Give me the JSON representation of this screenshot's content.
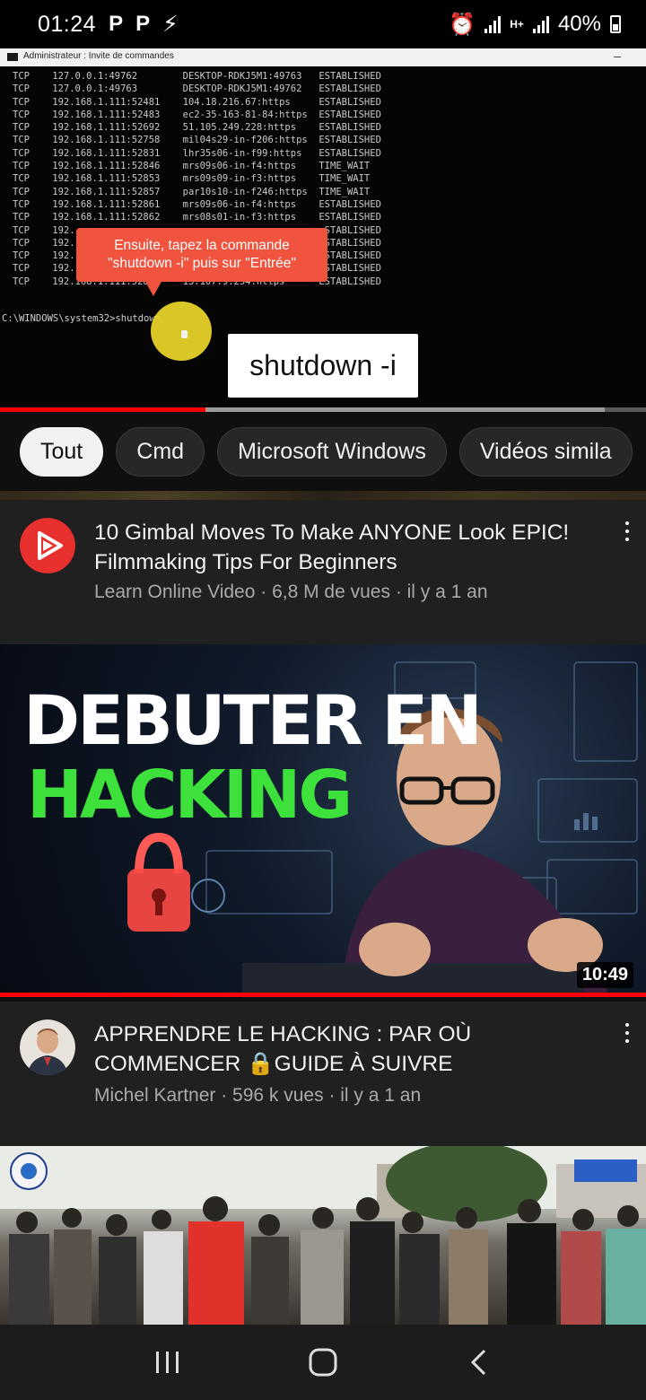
{
  "status_bar": {
    "time": "01:24",
    "left_icons": [
      "P",
      "P"
    ],
    "network": "H+",
    "battery": "40%"
  },
  "player": {
    "window_title": "Administrateur : Invite de commandes",
    "cmd_lines": [
      "TCP    127.0.0.1:49762        DESKTOP-RDKJ5M1:49763   ESTABLISHED",
      "TCP    127.0.0.1:49763        DESKTOP-RDKJ5M1:49762   ESTABLISHED",
      "TCP    192.168.1.111:52481    104.18.216.67:https     ESTABLISHED",
      "TCP    192.168.1.111:52483    ec2-35-163-81-84:https  ESTABLISHED",
      "TCP    192.168.1.111:52692    51.105.249.228:https    ESTABLISHED",
      "TCP    192.168.1.111:52758    mil04s29-in-f206:https  ESTABLISHED",
      "TCP    192.168.1.111:52831    lhr35s06-in-f99:https   ESTABLISHED",
      "TCP    192.168.1.111:52846    mrs09s06-in-f4:https    TIME_WAIT",
      "TCP    192.168.1.111:52853    mrs09s09-in-f3:https    TIME_WAIT",
      "TCP    192.168.1.111:52857    par10s10-in-f246:https  TIME_WAIT",
      "TCP    192.168.1.111:52861    mrs09s06-in-f4:https    ESTABLISHED",
      "TCP    192.168.1.111:52862    mrs08s01-in-f3:https    ESTABLISHED",
      "TCP    192.                                            STABLISHED",
      "TCP    192.                                            STABLISHED",
      "TCP    192.                                            STABLISHED",
      "TCP    192.                                            STABLISHED",
      "TCP    192.168.1.111:528      13.107.9.254:https      ESTABLISHED"
    ],
    "prompt": "C:\\WINDOWS\\system32>shutdown",
    "callout_line1": "Ensuite, tapez la commande",
    "callout_line2": "\"shutdown -i\" puis sur \"Entrée\"",
    "caption": "shutdown -i",
    "progress_played": 0.318,
    "progress_buffered": 0.936
  },
  "chips": [
    "Tout",
    "Cmd",
    "Microsoft Windows",
    "Vidéos simila"
  ],
  "videos": [
    {
      "title": "10 Gimbal Moves To Make ANYONE Look EPIC! Filmmaking Tips For Beginners",
      "meta": "Learn Online Video · 6,8 M de vues · il y a 1 an"
    },
    {
      "thumb_line1": "DEBUTER EN",
      "thumb_line2": "HACKING",
      "duration": "10:49",
      "title": "APPRENDRE LE HACKING : PAR OÙ COMMENCER 🔒GUIDE À SUIVRE",
      "meta": "Michel Kartner · 596 k vues · il y a 1 an"
    }
  ],
  "colors": {
    "accent": "#ff0000",
    "callout": "#f0533e",
    "hacking_green": "#3ee13b"
  }
}
